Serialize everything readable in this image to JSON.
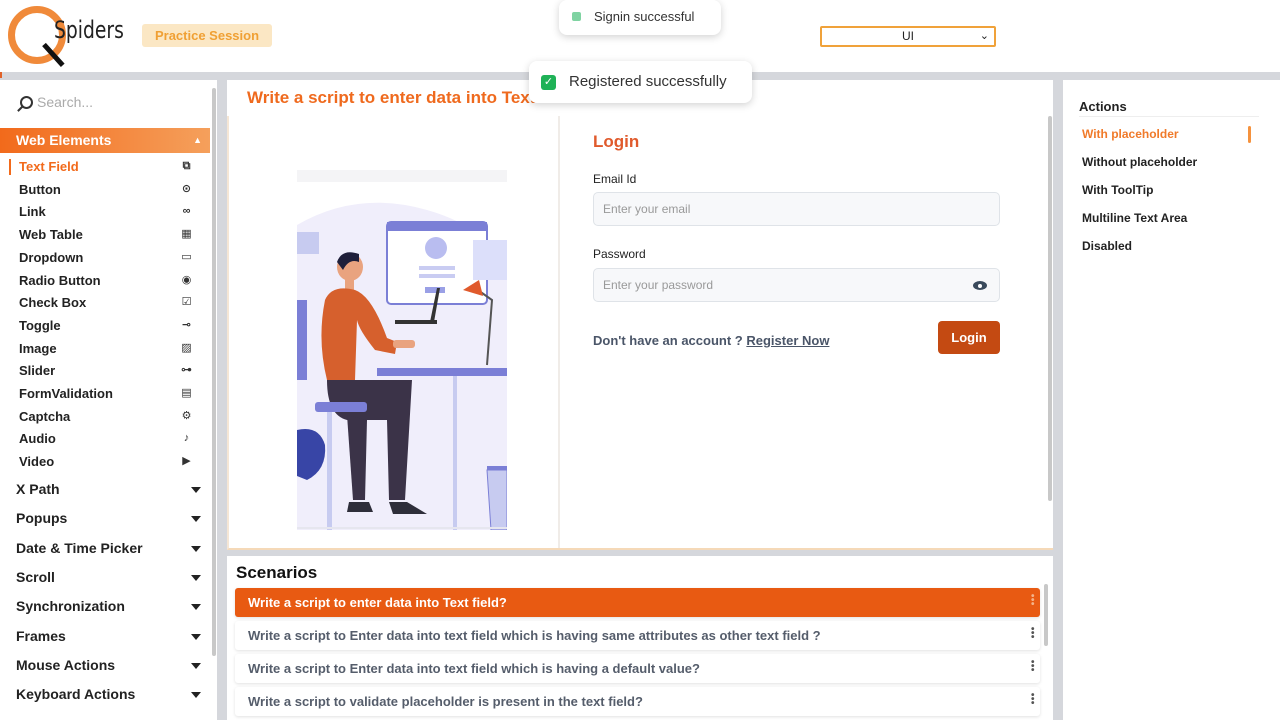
{
  "header": {
    "logo_text": "Spiders",
    "session_badge": "Practice Session",
    "select_value": "UI"
  },
  "toasts": {
    "signin": "Signin successful",
    "registered": "Registered successfully"
  },
  "sidebar": {
    "search_placeholder": "Search...",
    "section": "Web Elements",
    "items": [
      {
        "label": "Text Field",
        "icon": "text-field-icon",
        "glyph": "⧉"
      },
      {
        "label": "Button",
        "icon": "play-circle-icon",
        "glyph": "⊙"
      },
      {
        "label": "Link",
        "icon": "link-icon",
        "glyph": "∞"
      },
      {
        "label": "Web Table",
        "icon": "table-icon",
        "glyph": "▦"
      },
      {
        "label": "Dropdown",
        "icon": "dropdown-icon",
        "glyph": "▭"
      },
      {
        "label": "Radio Button",
        "icon": "radio-icon",
        "glyph": "◉"
      },
      {
        "label": "Check Box",
        "icon": "checkbox-icon",
        "glyph": "☑"
      },
      {
        "label": "Toggle",
        "icon": "toggle-icon",
        "glyph": "⊸"
      },
      {
        "label": "Image",
        "icon": "image-icon",
        "glyph": "▨"
      },
      {
        "label": "Slider",
        "icon": "slider-icon",
        "glyph": "⊶"
      },
      {
        "label": "FormValidation",
        "icon": "form-icon",
        "glyph": "▤"
      },
      {
        "label": "Captcha",
        "icon": "captcha-icon",
        "glyph": "⚙"
      },
      {
        "label": "Audio",
        "icon": "audio-icon",
        "glyph": "♪"
      },
      {
        "label": "Video",
        "icon": "video-icon",
        "glyph": "▶"
      }
    ],
    "groups": [
      "X Path",
      "Popups",
      "Date & Time Picker",
      "Scroll",
      "Synchronization",
      "Frames",
      "Mouse Actions",
      "Keyboard Actions"
    ]
  },
  "main": {
    "title": "Write a script to enter data into Text field.",
    "login": {
      "title": "Login",
      "email_label": "Email Id",
      "email_placeholder": "Enter your email",
      "password_label": "Password",
      "password_placeholder": "Enter your password",
      "no_account": "Don't have an account ?",
      "register": "Register Now",
      "button": "Login"
    }
  },
  "scenarios": {
    "title": "Scenarios",
    "items": [
      "Write a script to enter data into Text field?",
      "Write a script to Enter data into text field which is having same attributes as other text field ?",
      "Write a script to Enter data into text field which is having a default value?",
      "Write a script to validate placeholder is present in the text field?"
    ]
  },
  "actions": {
    "title": "Actions",
    "items": [
      "With placeholder",
      "Without placeholder",
      "With ToolTip",
      "Multiline Text Area",
      "Disabled"
    ]
  },
  "colors": {
    "accent": "#f26a1b",
    "login_button": "#c44a12",
    "success": "#1fb257"
  }
}
